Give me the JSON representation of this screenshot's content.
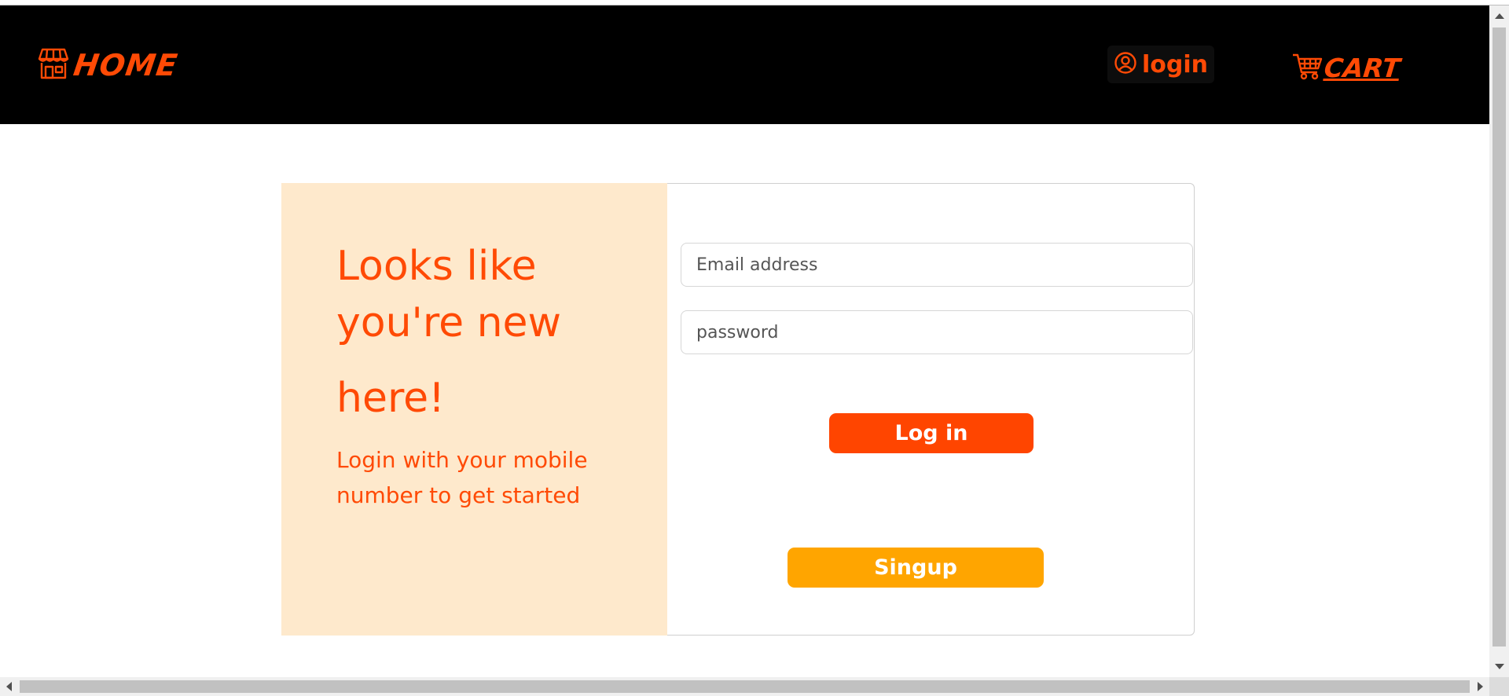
{
  "navbar": {
    "brand_label": "HOME",
    "brand_icon": "store-icon",
    "login_label": "login",
    "login_icon": "user-circle-icon",
    "cart_label": "CART",
    "cart_icon": "cart-icon",
    "accent_color": "#ff4a05",
    "background_color": "#000000"
  },
  "left_panel": {
    "headline_line1": "Looks like",
    "headline_line2": "you're new",
    "headline_line3": "here!",
    "subtext": "Login with your mobile number to get started",
    "background_color": "#fee9cc"
  },
  "form": {
    "email_placeholder": "Email address",
    "email_value": "",
    "password_placeholder": "password",
    "password_value": "",
    "login_button_label": "Log in",
    "login_button_color": "#ff4500",
    "signup_button_label": "Singup",
    "signup_button_color": "#ffa500"
  }
}
